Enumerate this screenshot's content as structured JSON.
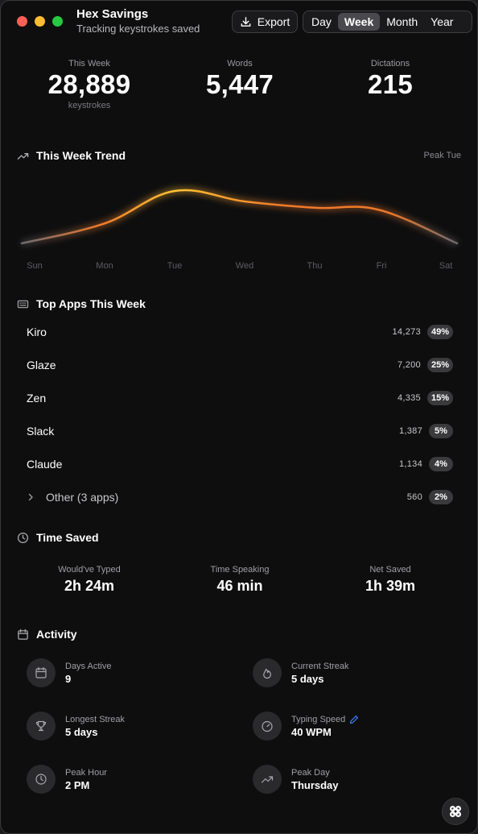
{
  "app": {
    "title": "Hex Savings",
    "subtitle": "Tracking keystrokes saved"
  },
  "toolbar": {
    "export_label": "Export",
    "range_options": [
      "Day",
      "Week",
      "Month",
      "Year"
    ],
    "selected_range": "Week"
  },
  "stats": [
    {
      "label": "This Week",
      "value": "28,889",
      "unit": "keystrokes"
    },
    {
      "label": "Words",
      "value": "5,447"
    },
    {
      "label": "Dictations",
      "value": "215"
    }
  ],
  "trend": {
    "title": "This Week Trend",
    "peak_label": "Peak Tue",
    "days": [
      "Sun",
      "Mon",
      "Tue",
      "Wed",
      "Thu",
      "Fri",
      "Sat"
    ],
    "relative_values": [
      0.0,
      0.38,
      1.0,
      0.8,
      0.68,
      0.64,
      0.0
    ]
  },
  "top_apps": {
    "title": "Top Apps This Week",
    "apps": [
      {
        "name": "Kiro",
        "count": "14,273",
        "percent": "49%"
      },
      {
        "name": "Glaze",
        "count": "7,200",
        "percent": "25%"
      },
      {
        "name": "Zen",
        "count": "4,335",
        "percent": "15%"
      },
      {
        "name": "Slack",
        "count": "1,387",
        "percent": "5%"
      },
      {
        "name": "Claude",
        "count": "1,134",
        "percent": "4%"
      }
    ],
    "other": {
      "name": "Other (3 apps)",
      "count": "560",
      "percent": "2%"
    }
  },
  "time_saved": {
    "title": "Time Saved",
    "items": [
      {
        "label": "Would've Typed",
        "value": "2h 24m"
      },
      {
        "label": "Time Speaking",
        "value": "46 min"
      },
      {
        "label": "Net Saved",
        "value": "1h 39m"
      }
    ]
  },
  "activity": {
    "title": "Activity",
    "items": [
      {
        "label": "Days Active",
        "value": "9",
        "icon": "calendar-icon"
      },
      {
        "label": "Current Streak",
        "value": "5 days",
        "icon": "flame-icon"
      },
      {
        "label": "Longest Streak",
        "value": "5 days",
        "icon": "trophy-icon"
      },
      {
        "label": "Typing Speed",
        "value": "40 WPM",
        "icon": "gauge-icon"
      },
      {
        "label": "Peak Hour",
        "value": "2 PM",
        "icon": "clock-icon"
      },
      {
        "label": "Peak Day",
        "value": "Thursday",
        "icon": "trend-up-icon"
      }
    ]
  },
  "colors": {
    "accent_trend_peak": "#ffc233",
    "accent_trend_mid": "#f07a2a",
    "accent_trend_edge": "#6a6a70",
    "edit_icon": "#3b82f6"
  }
}
